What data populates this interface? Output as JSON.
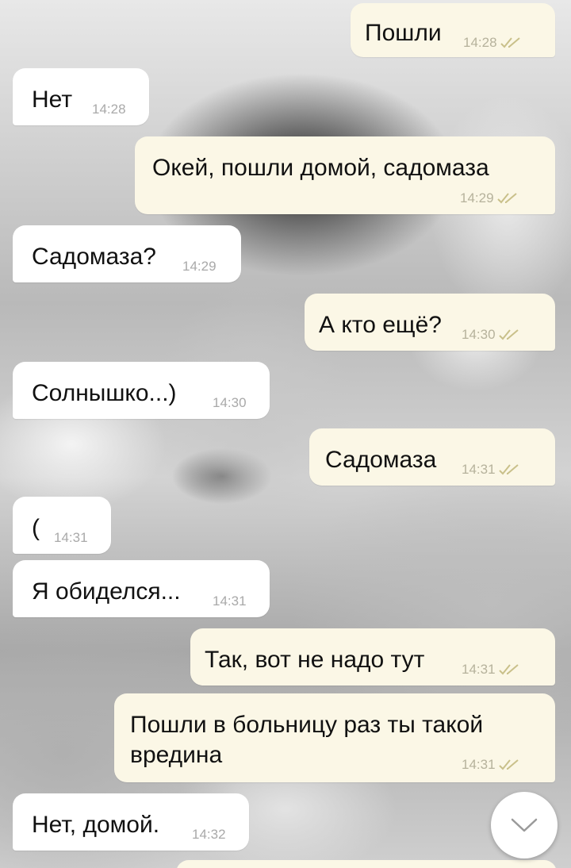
{
  "chat": {
    "messages": [
      {
        "direction": "outgoing",
        "text": "Пошли",
        "time": "14:28",
        "read_icon": "double-check-icon"
      },
      {
        "direction": "incoming",
        "text": "Нет",
        "time": "14:28"
      },
      {
        "direction": "outgoing",
        "text": "Окей, пошли домой, садомаза",
        "time": "14:29",
        "read_icon": "double-check-icon"
      },
      {
        "direction": "incoming",
        "text": "Садомаза?",
        "time": "14:29"
      },
      {
        "direction": "outgoing",
        "text": "А кто ещё?",
        "time": "14:30",
        "read_icon": "double-check-icon"
      },
      {
        "direction": "incoming",
        "text": "Солнышко...)",
        "time": "14:30"
      },
      {
        "direction": "outgoing",
        "text": "Садомаза",
        "time": "14:31",
        "read_icon": "double-check-icon"
      },
      {
        "direction": "incoming",
        "text": "(",
        "time": "14:31"
      },
      {
        "direction": "incoming",
        "text": "Я обиделся...",
        "time": "14:31"
      },
      {
        "direction": "outgoing",
        "text": "Так, вот не надо тут",
        "time": "14:31",
        "read_icon": "double-check-icon"
      },
      {
        "direction": "outgoing",
        "text_line1": "Пошли в больницу раз ты такой",
        "text_line2": "вредина",
        "time": "14:31",
        "read_icon": "double-check-icon"
      },
      {
        "direction": "incoming",
        "text": "Нет, домой.",
        "time": "14:32"
      }
    ]
  },
  "colors": {
    "incoming_bubble": "#ffffff",
    "outgoing_bubble": "#fbf7e6",
    "read_check": "#c9c08a",
    "time_text": "#a9a9a9"
  },
  "scroll_button": {
    "icon": "chevron-down-icon"
  }
}
